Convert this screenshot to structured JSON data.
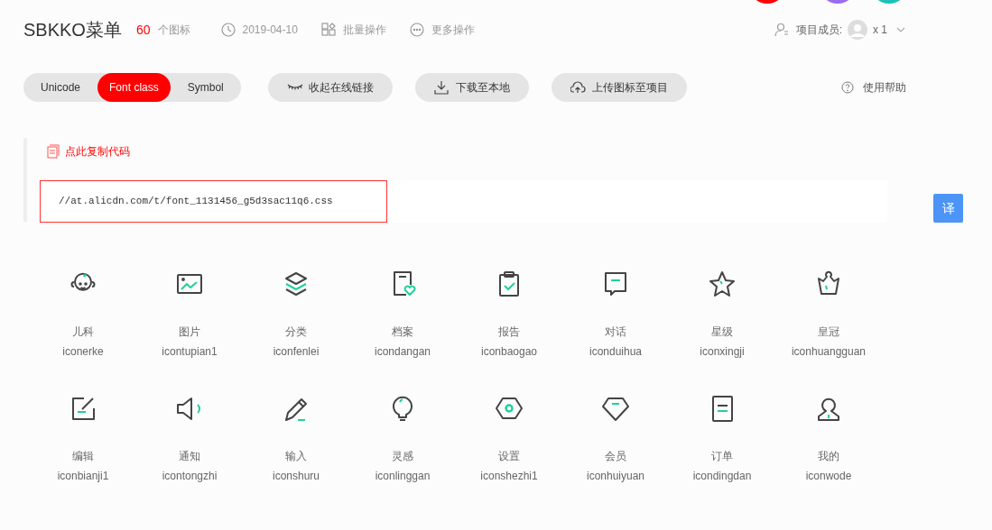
{
  "decor_circles": [
    {
      "color": "#ff0000"
    },
    {
      "color": "#9b6bf2"
    },
    {
      "color": "#1cc1b8"
    }
  ],
  "header": {
    "title": "SBKKO菜单",
    "count": "60",
    "count_label": "个图标",
    "date": "2019-04-10",
    "batch": "批量操作",
    "more": "更多操作",
    "members_label": "项目成员:",
    "members_count": "x 1"
  },
  "tabs": [
    {
      "label": "Unicode",
      "selected": false
    },
    {
      "label": "Font class",
      "selected": true
    },
    {
      "label": "Symbol",
      "selected": false
    }
  ],
  "actions": [
    {
      "kind": "eye",
      "label": "收起在线链接"
    },
    {
      "kind": "download",
      "label": "下载至本地"
    },
    {
      "kind": "upload",
      "label": "上传图标至项目"
    }
  ],
  "help": "使用帮助",
  "copy_link": "点此复制代码",
  "code": "//at.alicdn.com/t/font_1131456_g5d3sac11q6.css",
  "translate_button": "译",
  "icons": [
    {
      "kind": "baby",
      "label": "儿科",
      "name": "iconerke"
    },
    {
      "kind": "image",
      "label": "图片",
      "name": "icontupian1"
    },
    {
      "kind": "layers",
      "label": "分类",
      "name": "iconfenlei"
    },
    {
      "kind": "file-heart",
      "label": "档案",
      "name": "icondangan"
    },
    {
      "kind": "clipboard",
      "label": "报告",
      "name": "iconbaogao"
    },
    {
      "kind": "chat",
      "label": "对话",
      "name": "iconduihua"
    },
    {
      "kind": "star",
      "label": "星级",
      "name": "iconxingji"
    },
    {
      "kind": "crown",
      "label": "皇冠",
      "name": "iconhuangguan"
    },
    {
      "kind": "edit",
      "label": "编辑",
      "name": "iconbianji1"
    },
    {
      "kind": "speaker",
      "label": "通知",
      "name": "icontongzhi"
    },
    {
      "kind": "pencil",
      "label": "输入",
      "name": "iconshuru"
    },
    {
      "kind": "bulb",
      "label": "灵感",
      "name": "iconlinggan"
    },
    {
      "kind": "hexagon",
      "label": "设置",
      "name": "iconshezhi1"
    },
    {
      "kind": "gem",
      "label": "会员",
      "name": "iconhuiyuan"
    },
    {
      "kind": "document",
      "label": "订单",
      "name": "icondingdan"
    },
    {
      "kind": "user",
      "label": "我的",
      "name": "iconwode"
    }
  ]
}
